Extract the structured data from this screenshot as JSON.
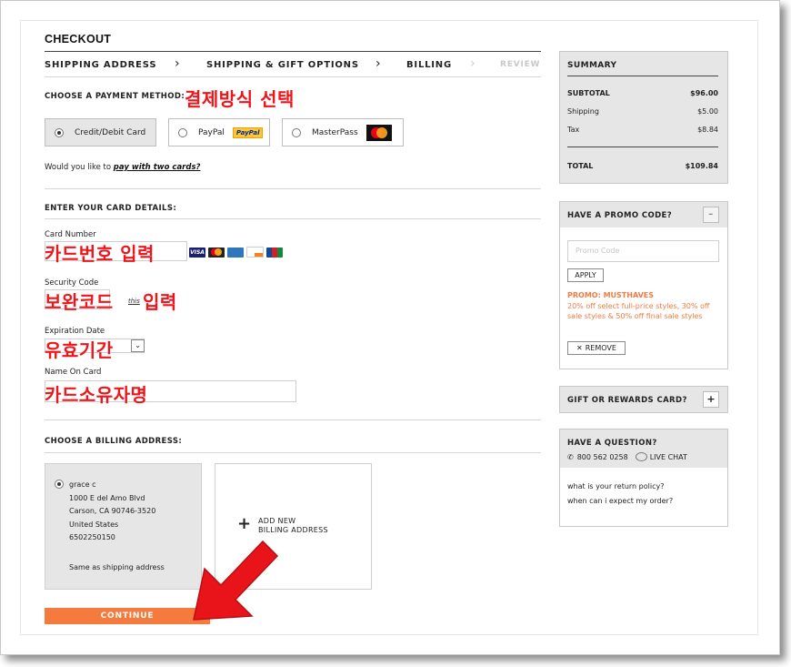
{
  "checkout": {
    "title": "CHECKOUT",
    "steps": [
      {
        "label": "SHIPPING ADDRESS"
      },
      {
        "label": "SHIPPING & GIFT OPTIONS"
      },
      {
        "label": "BILLING"
      },
      {
        "label": "REVIEW"
      }
    ]
  },
  "payment": {
    "heading": "CHOOSE A PAYMENT METHOD:",
    "annotation": "결제방식 선택",
    "options": [
      {
        "label": "Credit/Debit Card",
        "selected": true
      },
      {
        "label": "PayPal",
        "badge": "PayPal",
        "selected": false
      },
      {
        "label": "MasterPass",
        "selected": false
      }
    ],
    "two_cards_prefix": "Would you like to ",
    "two_cards_link": "pay with two cards?"
  },
  "card": {
    "heading": "ENTER YOUR CARD DETAILS:",
    "number_label": "Card Number",
    "number_annotation": "카드번호 입력",
    "card_brands": [
      "VISA",
      "MasterCard",
      "AMEX",
      "DISCOVER",
      "JCB"
    ],
    "security_label": "Security Code",
    "security_annotation": "보완코드",
    "security_annotation_2": "입력",
    "security_hint": "this",
    "expiration_label": "Expiration Date",
    "expiration_annotation": "유효기간",
    "name_label": "Name On Card",
    "name_annotation": "카드소유자명"
  },
  "billing": {
    "heading": "CHOOSE A BILLING ADDRESS:",
    "address": {
      "name": "grace c",
      "line1": "1000 E del Amo Blvd",
      "line2": "Carson, CA 90746-3520",
      "country": "United States",
      "phone": "6502250150",
      "note": "Same as shipping address"
    },
    "add_new_line1": "ADD NEW",
    "add_new_line2": "BILLING ADDRESS",
    "continue_label": "CONTINUE"
  },
  "summary": {
    "title": "SUMMARY",
    "subtotal_label": "SUBTOTAL",
    "subtotal": "$96.00",
    "shipping_label": "Shipping",
    "shipping": "$5.00",
    "tax_label": "Tax",
    "tax": "$8.84",
    "total_label": "TOTAL",
    "total": "$109.84"
  },
  "promo": {
    "title": "HAVE A PROMO CODE?",
    "toggle": "–",
    "placeholder": "Promo Code",
    "apply": "APPLY",
    "applied_title": "PROMO: MUSTHAVES",
    "applied_desc": "20% off select full-price styles, 30% off sale styles & 50% off final sale styles",
    "remove": "REMOVE"
  },
  "gift": {
    "title": "GIFT OR REWARDS CARD?",
    "toggle": "+"
  },
  "help": {
    "title": "HAVE A QUESTION?",
    "phone": "800 562 0258",
    "chat": "LIVE CHAT",
    "faq1": "what is your return policy?",
    "faq2": "when can i expect my order?"
  },
  "colors": {
    "accent": "#f47a3e",
    "annotation_red": "#f0151b",
    "panel_gray": "#e6e6e6"
  }
}
